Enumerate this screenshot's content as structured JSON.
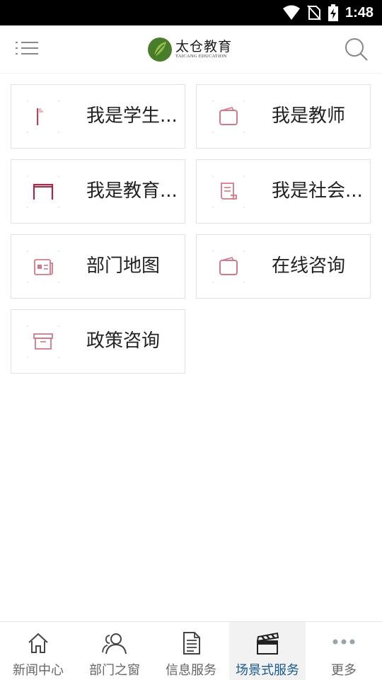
{
  "status": {
    "time": "1:48"
  },
  "header": {
    "logo_cn": "太仓教育",
    "logo_en": "TAICANG EDUCATION"
  },
  "cards": [
    {
      "label": "我是学生...",
      "icon": "student-flag-icon"
    },
    {
      "label": "我是教师",
      "icon": "wallet-icon"
    },
    {
      "label": "我是教育...",
      "icon": "door-frame-icon"
    },
    {
      "label": "我是社会...",
      "icon": "scroll-icon"
    },
    {
      "label": "部门地图",
      "icon": "newspaper-icon"
    },
    {
      "label": "在线咨询",
      "icon": "wallet-icon"
    },
    {
      "label": "政策咨询",
      "icon": "archive-box-icon"
    }
  ],
  "tabs": [
    {
      "label": "新闻中心",
      "icon": "home-icon"
    },
    {
      "label": "部门之窗",
      "icon": "people-icon"
    },
    {
      "label": "信息服务",
      "icon": "document-icon"
    },
    {
      "label": "场景式服务",
      "icon": "clapperboard-icon",
      "active": true
    },
    {
      "label": "更多",
      "icon": "more-dots-icon"
    }
  ],
  "colors": {
    "accent": "#1a5a8c",
    "icon": "#b5455a",
    "border": "#e2e2e2"
  }
}
